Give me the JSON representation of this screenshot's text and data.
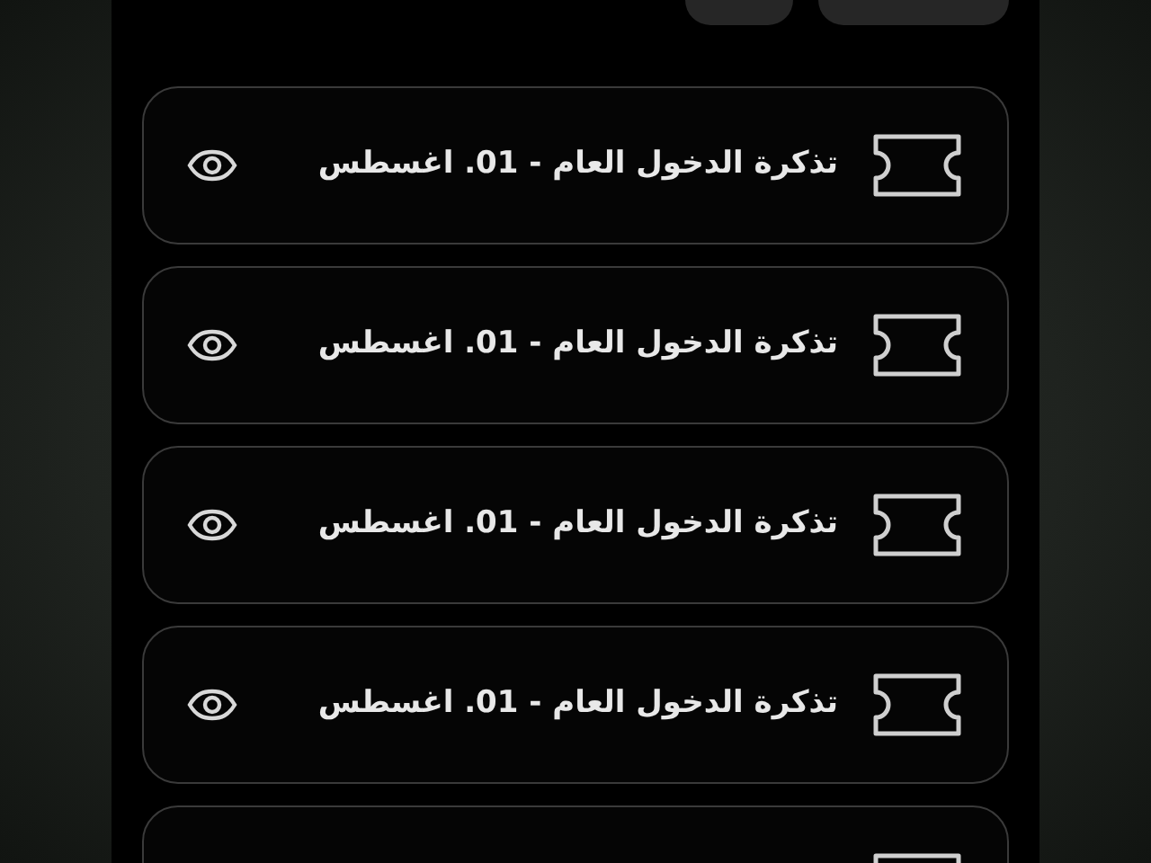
{
  "filter_chips": [
    {
      "kind": "chip"
    },
    {
      "kind": "chip"
    }
  ],
  "tickets": [
    {
      "kind": "full",
      "title": "تذكرة الدخول العام - 01. اغسطس"
    },
    {
      "kind": "full",
      "title": "تذكرة الدخول العام - 01. اغسطس"
    },
    {
      "kind": "full",
      "title": "تذكرة الدخول العام - 01. اغسطس"
    },
    {
      "kind": "full",
      "title": "تذكرة الدخول العام - 01. اغسطس"
    },
    {
      "kind": "cut_off"
    }
  ]
}
